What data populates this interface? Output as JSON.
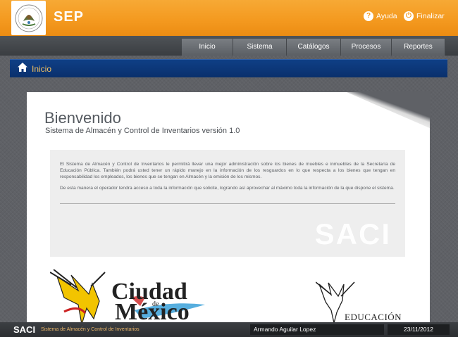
{
  "header": {
    "brand": "SEP",
    "help_label": "Ayuda",
    "logout_label": "Finalizar"
  },
  "nav": {
    "items": [
      {
        "label": "Inicio"
      },
      {
        "label": "Sistema"
      },
      {
        "label": "Catálogos"
      },
      {
        "label": "Procesos"
      },
      {
        "label": "Reportes"
      }
    ]
  },
  "breadcrumb": {
    "label": "Inicio"
  },
  "main": {
    "welcome": "Bienvenido",
    "subtitle": "Sistema de Almacén y Control de Inventarios versión 1.0",
    "paragraph1": "El Sistema de Almacén y Control de Inventarios le permitirá llevar una mejor administración sobre los bienes de muebles e inmuebles de la Secretaría de Educación Pública. También podrá usted tener un rápido manejo en la información de los resguardos en lo que respecta a los bienes que tengan en responsabilidad los empleados, los bienes que se tengan en Almacén y la emisión de los mismos.",
    "paragraph2": "De esta manera el operador tendra acceso a toda la información que solicite, logrando así aprovechar al máximo toda la información de la que dispone el sistema.",
    "watermark": "SACI",
    "logo_cdmx_line1": "Ciudad",
    "logo_cdmx_de": "de",
    "logo_cdmx_line2": "México",
    "logo_edu": "EDUCACIÓN"
  },
  "footer": {
    "brand": "SACI",
    "subtitle": "Sistema de Almacén y Control de Inventarios",
    "user": "Armando Aguilar Lopez",
    "date": "23/11/2012"
  },
  "colors": {
    "header_orange": "#f49a20",
    "breadcrumb_blue": "#0a306c",
    "breadcrumb_text": "#f0c060",
    "footer_accent": "#e8b56a"
  }
}
